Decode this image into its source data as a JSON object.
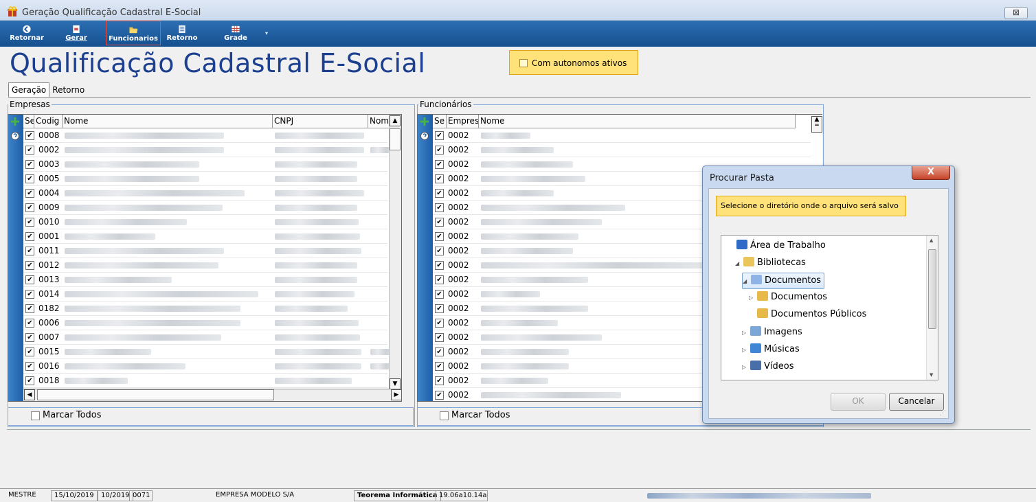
{
  "window": {
    "title": "Geração Qualificação Cadastral E-Social",
    "close_glyph": "⊠"
  },
  "toolbar": [
    {
      "label": "Retornar",
      "icon": "back-arrow-icon",
      "active": false
    },
    {
      "label": "Gerar",
      "icon": "generate-document-icon",
      "active": false
    },
    {
      "label": "Funcionarios",
      "icon": "folder-open-icon",
      "active": true
    },
    {
      "label": "Retorno",
      "icon": "return-file-icon",
      "active": false
    },
    {
      "label": "Grade",
      "icon": "grid-table-icon",
      "active": false
    }
  ],
  "toolbar_more": "▾",
  "page": {
    "title": "Qualificação Cadastral E-Social",
    "autonomos_label": "Com autonomos ativos",
    "autonomos_checked": false
  },
  "tabs": [
    "Geração",
    "Retorno"
  ],
  "empresas": {
    "group_label": "Empresas",
    "columns": [
      "Se",
      "Codig",
      "Nome",
      "CNPJ",
      "Nome f"
    ],
    "codes": [
      "0008",
      "0002",
      "0003",
      "0005",
      "0004",
      "0009",
      "0010",
      "0001",
      "0011",
      "0012",
      "0013",
      "0014",
      "0182",
      "0006",
      "0007",
      "0015",
      "0016",
      "0018"
    ],
    "marcar_todos": "Marcar Todos"
  },
  "funcionarios": {
    "group_label": "Funcionários",
    "columns": [
      "Se",
      "Empres",
      "Nome"
    ],
    "codes": [
      "0002",
      "0002",
      "0002",
      "0002",
      "0002",
      "0002",
      "0002",
      "0002",
      "0002",
      "0002",
      "0002",
      "0002",
      "0002",
      "0002",
      "0002",
      "0002",
      "0002",
      "0002",
      "0002"
    ],
    "marcar_todos": "Marcar Todos"
  },
  "dialog": {
    "title": "Procurar Pasta",
    "close_glyph": "X",
    "note": "Selecione o diretório onde o arquivo será salvo",
    "tree": [
      {
        "label": "Área de Trabalho",
        "indent": 0,
        "expander": "",
        "icon": "desktop-icon"
      },
      {
        "label": "Bibliotecas",
        "indent": 1,
        "expander": "◢",
        "icon": "libraries-icon"
      },
      {
        "label": "Documentos",
        "indent": 2,
        "expander": "◢",
        "icon": "documents-library-icon",
        "selected": true
      },
      {
        "label": "Documentos",
        "indent": 3,
        "expander": "▷",
        "icon": "documents-folder-icon"
      },
      {
        "label": "Documentos Públicos",
        "indent": 3,
        "expander": "",
        "icon": "public-documents-folder-icon"
      },
      {
        "label": "Imagens",
        "indent": 2,
        "expander": "▷",
        "icon": "pictures-library-icon"
      },
      {
        "label": "Músicas",
        "indent": 2,
        "expander": "▷",
        "icon": "music-library-icon"
      },
      {
        "label": "Vídeos",
        "indent": 2,
        "expander": "▷",
        "icon": "videos-library-icon"
      }
    ],
    "ok_label": "OK",
    "cancel_label": "Cancelar"
  },
  "statusbar": {
    "user": "MESTRE",
    "date": "15/10/2019",
    "period": "10/2019",
    "code": "0071",
    "company": "EMPRESA MODELO S/A",
    "vendor": "Teorema Informática",
    "version": "19.06a10.14a"
  },
  "colors": {
    "toolbar": "#15508f",
    "highlight": "#ffe27a",
    "title": "#1c3f8f",
    "dialog_close": "#c7432a"
  }
}
